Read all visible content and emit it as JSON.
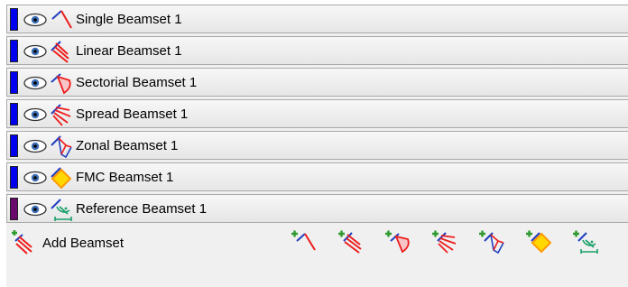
{
  "beamsets": [
    {
      "label": "Single Beamset 1",
      "color": "#0000ee",
      "icon": "single-beam-icon"
    },
    {
      "label": "Linear Beamset 1",
      "color": "#0000ee",
      "icon": "linear-beam-icon"
    },
    {
      "label": "Sectorial Beamset 1",
      "color": "#0000ee",
      "icon": "sectorial-beam-icon"
    },
    {
      "label": "Spread Beamset 1",
      "color": "#0000ee",
      "icon": "spread-beam-icon"
    },
    {
      "label": "Zonal Beamset 1",
      "color": "#0000ee",
      "icon": "zonal-beam-icon"
    },
    {
      "label": "FMC Beamset 1",
      "color": "#0000ee",
      "icon": "fmc-beam-icon"
    },
    {
      "label": "Reference Beamset 1",
      "color": "#6a0a6a",
      "icon": "reference-beam-icon"
    }
  ],
  "footer": {
    "add_label": "Add Beamset",
    "add_icon": "add-beamset-icon",
    "quick_add_icons": [
      "add-single-beam-icon",
      "add-linear-beam-icon",
      "add-sectorial-beam-icon",
      "add-spread-beam-icon",
      "add-zonal-beam-icon",
      "add-fmc-beam-icon",
      "add-reference-beam-icon"
    ]
  },
  "colors": {
    "beam_red": "#ee1c1c",
    "beam_blue": "#1f3fbf",
    "fmc_orange": "#ff9900",
    "fmc_yellow": "#ffd800",
    "reference_green": "#1aa06a",
    "plus_green": "#2e9a2e"
  }
}
